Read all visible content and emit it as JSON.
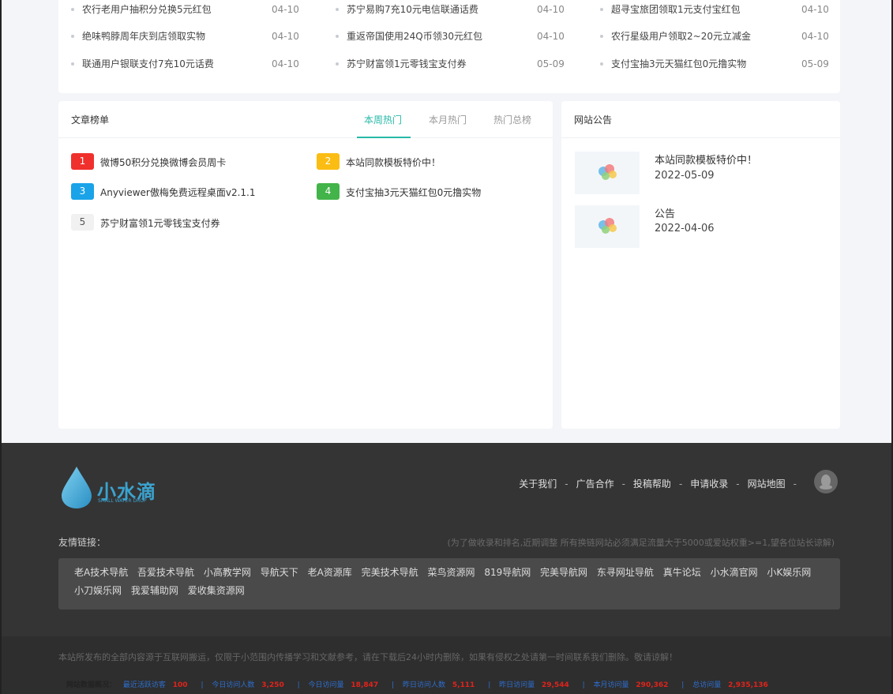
{
  "news": {
    "rows": [
      [
        {
          "title": "农行老用户抽积分兑换5元红包",
          "date": "04-10"
        },
        {
          "title": "苏宁易购7充10元电信联通话费",
          "date": "04-10"
        },
        {
          "title": "超寻宝旅团领取1元支付宝红包",
          "date": "04-10"
        }
      ],
      [
        {
          "title": "绝味鸭脖周年庆到店领取实物",
          "date": "04-10"
        },
        {
          "title": "重返帝国使用24Q币领30元红包",
          "date": "04-10"
        },
        {
          "title": "农行星级用户领取2~20元立减金",
          "date": "04-10"
        }
      ],
      [
        {
          "title": "联通用户银联支付7充10元话费",
          "date": "04-10"
        },
        {
          "title": "苏宁财富领1元零钱宝支付券",
          "date": "05-09"
        },
        {
          "title": "支付宝抽3元天猫红包0元撸实物",
          "date": "05-09"
        }
      ]
    ]
  },
  "ranking": {
    "title": "文章榜单",
    "tabs": [
      "本周热门",
      "本月热门",
      "热门总榜"
    ],
    "items": [
      {
        "num": "1",
        "text": "微博50积分兑换微博会员周卡",
        "color": "#f0302c"
      },
      {
        "num": "2",
        "text": "本站同款模板特价中！",
        "color": "#fbbd13"
      },
      {
        "num": "3",
        "text": "Anyviewer傲梅免费远程桌面v2.1.1",
        "color": "#1aa3e8"
      },
      {
        "num": "4",
        "text": "支付宝抽3元天猫红包0元撸实物",
        "color": "#43b449"
      },
      {
        "num": "5",
        "text": "苏宁财富领1元零钱宝支付券",
        "color": "#f1f1f1"
      }
    ]
  },
  "notice": {
    "title": "网站公告",
    "items": [
      {
        "title": "本站同款模板特价中！",
        "date": "2022-05-09"
      },
      {
        "title": "公告",
        "date": "2022-04-06"
      }
    ]
  },
  "footer": {
    "logo_text": "小水滴",
    "logo_sub": "SMALL WATER DROP",
    "nav": [
      "关于我们",
      "广告合作",
      "投稿帮助",
      "申请收录",
      "网站地图"
    ],
    "nav_sep": "-",
    "friend_label": "友情链接：",
    "friend_note": "(为了做收录和排名,近期调整 所有换链网站必须满足流量大于5000或爱站权重>=1,望各位站长谅解)",
    "links": [
      "老A技术导航",
      "吾爱技术导航",
      "小高教学网",
      "导航天下",
      "老A资源库",
      "完美技术导航",
      "菜鸟资源网",
      "819导航网",
      "完美导航网",
      "东寻网址导航",
      "真牛论坛",
      "小水滴官网",
      "小K娱乐网",
      "小刀娱乐网",
      "我爱辅助网",
      "爱收集资源网"
    ],
    "disclaimer": "本站所发布的全部内容源于互联网搬运，仅限于小范围内传播学习和文献参考，请在下载后24小时内删除，如果有侵权之处请第一时间联系我们删除。敬请谅解！",
    "stats_title": "网站数据概况：",
    "stats": [
      {
        "label": "最近活跃访客",
        "value": "100"
      },
      {
        "label": "今日访问人数",
        "value": "3,250"
      },
      {
        "label": "今日访问量",
        "value": "18,847"
      },
      {
        "label": "昨日访问人数",
        "value": "5,111"
      },
      {
        "label": "昨日访问量",
        "value": "29,544"
      },
      {
        "label": "本月访问量",
        "value": "290,362"
      },
      {
        "label": "总访问量",
        "value": "2,935,136"
      }
    ]
  }
}
